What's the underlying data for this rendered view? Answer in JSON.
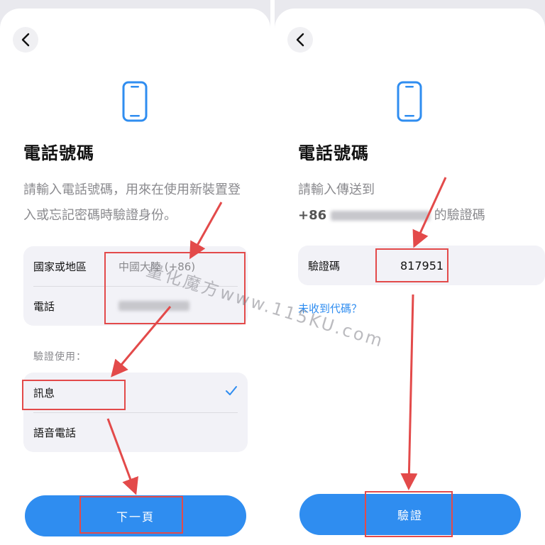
{
  "left": {
    "title": "電話號碼",
    "description": "請輸入電話號碼，用來在使用新裝置登入或忘記密碼時驗證身份。",
    "country_label": "國家或地區",
    "country_value": "中國大陸 (+86)",
    "phone_label": "電話",
    "verify_section_label": "驗證使用：",
    "option_sms": "訊息",
    "option_voice": "語音電話",
    "next_button": "下一頁"
  },
  "right": {
    "title": "電話號碼",
    "description_line1": "請輸入傳送到",
    "country_code": "+86",
    "description_suffix": "的驗證碼",
    "code_label": "驗證碼",
    "code_value": "817951",
    "resend_link": "未收到代碼？",
    "verify_button": "驗證"
  },
  "watermark": "量化魔方www.115KU.com",
  "colors": {
    "accent": "#2f8df0",
    "annotation_red": "#e34a4a",
    "background": "#e9e9ee"
  },
  "icons": [
    "back-chevron-icon",
    "smartphone-icon",
    "checkmark-icon"
  ]
}
